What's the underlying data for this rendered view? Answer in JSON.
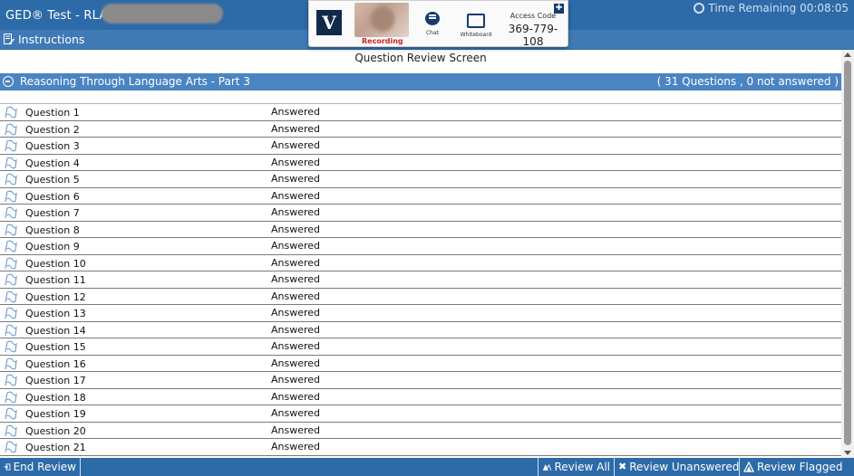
{
  "header": {
    "title": "GED® Test - RLA",
    "timer_label": "Time Remaining 00:08:05"
  },
  "instructions": {
    "label": "Instructions"
  },
  "proctor": {
    "logo_text": "V",
    "recording_label": "Recording",
    "chat_label": "Chat",
    "whiteboard_label": "Whiteboard",
    "access_code_label": "Access Code",
    "access_code": "369-779-108",
    "expand_symbol": "✚"
  },
  "screen_title": "Question Review Screen",
  "section": {
    "name": "Reasoning Through Language Arts - Part 3",
    "summary": "( 31 Questions , 0 not answered )"
  },
  "questions": [
    {
      "label": "Question 1",
      "status": "Answered"
    },
    {
      "label": "Question 2",
      "status": "Answered"
    },
    {
      "label": "Question 3",
      "status": "Answered"
    },
    {
      "label": "Question 4",
      "status": "Answered"
    },
    {
      "label": "Question 5",
      "status": "Answered"
    },
    {
      "label": "Question 6",
      "status": "Answered"
    },
    {
      "label": "Question 7",
      "status": "Answered"
    },
    {
      "label": "Question 8",
      "status": "Answered"
    },
    {
      "label": "Question 9",
      "status": "Answered"
    },
    {
      "label": "Question 10",
      "status": "Answered"
    },
    {
      "label": "Question 11",
      "status": "Answered"
    },
    {
      "label": "Question 12",
      "status": "Answered"
    },
    {
      "label": "Question 13",
      "status": "Answered"
    },
    {
      "label": "Question 14",
      "status": "Answered"
    },
    {
      "label": "Question 15",
      "status": "Answered"
    },
    {
      "label": "Question 16",
      "status": "Answered"
    },
    {
      "label": "Question 17",
      "status": "Answered"
    },
    {
      "label": "Question 18",
      "status": "Answered"
    },
    {
      "label": "Question 19",
      "status": "Answered"
    },
    {
      "label": "Question 20",
      "status": "Answered"
    },
    {
      "label": "Question 21",
      "status": "Answered"
    }
  ],
  "footer": {
    "end_review": "End Review",
    "review_all": "Review All",
    "review_unanswered": "Review Unanswered",
    "review_flagged": "Review Flagged"
  },
  "icons": {
    "flag": "flag-outline-icon",
    "end_review": "exit-icon",
    "review_all": "review-all-icon",
    "review_unanswered": "x-icon",
    "review_flagged": "flag-icon"
  },
  "colors": {
    "titlebar": "#2d6aa8",
    "section_header": "#4b84c2",
    "logo_bg": "#13294b",
    "recording": "#d02222"
  }
}
